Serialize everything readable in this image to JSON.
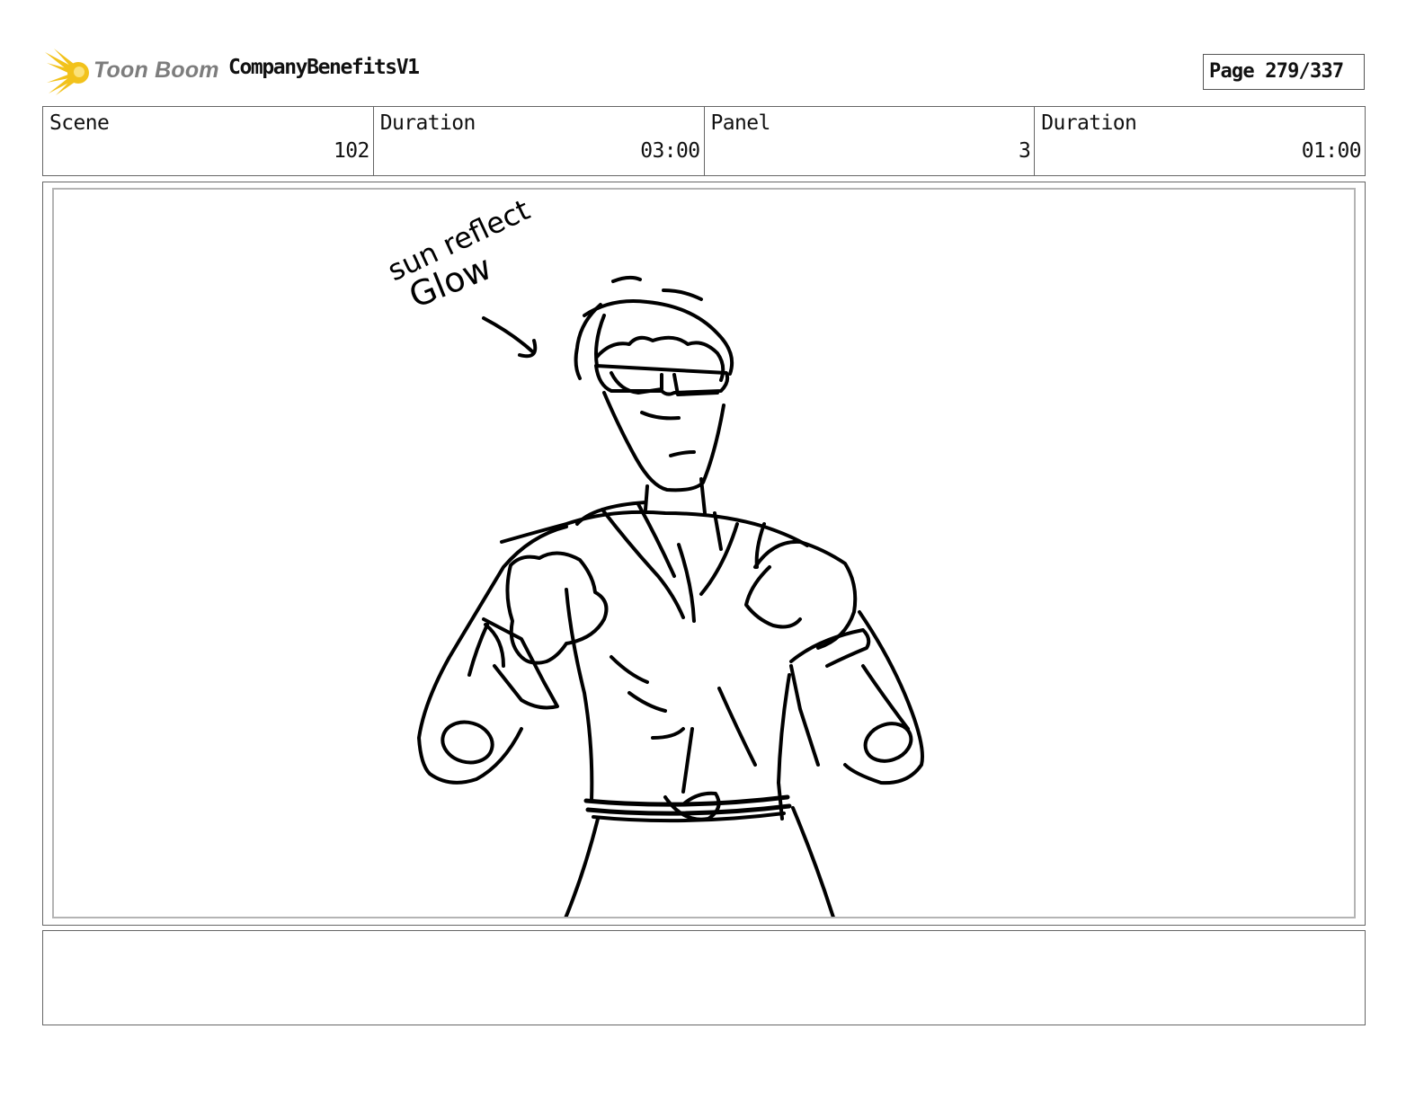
{
  "header": {
    "logo_text": "Toon Boom",
    "project_title": "CompanyBenefitsV1",
    "page_label": "Page 279/337"
  },
  "info": {
    "scene_label": "Scene",
    "scene_value": "102",
    "scene_duration_label": "Duration",
    "scene_duration_value": "03:00",
    "panel_label": "Panel",
    "panel_value": "3",
    "panel_duration_label": "Duration",
    "panel_duration_value": "01:00"
  },
  "sketch": {
    "annotation_line1": "sun reflect",
    "annotation_line2": "Glow"
  },
  "notes": {
    "text": ""
  },
  "colors": {
    "logo_accent": "#f2c21b",
    "logo_text": "#7d7d7d",
    "border": "#666666",
    "inner_border": "#b4b4b4"
  }
}
